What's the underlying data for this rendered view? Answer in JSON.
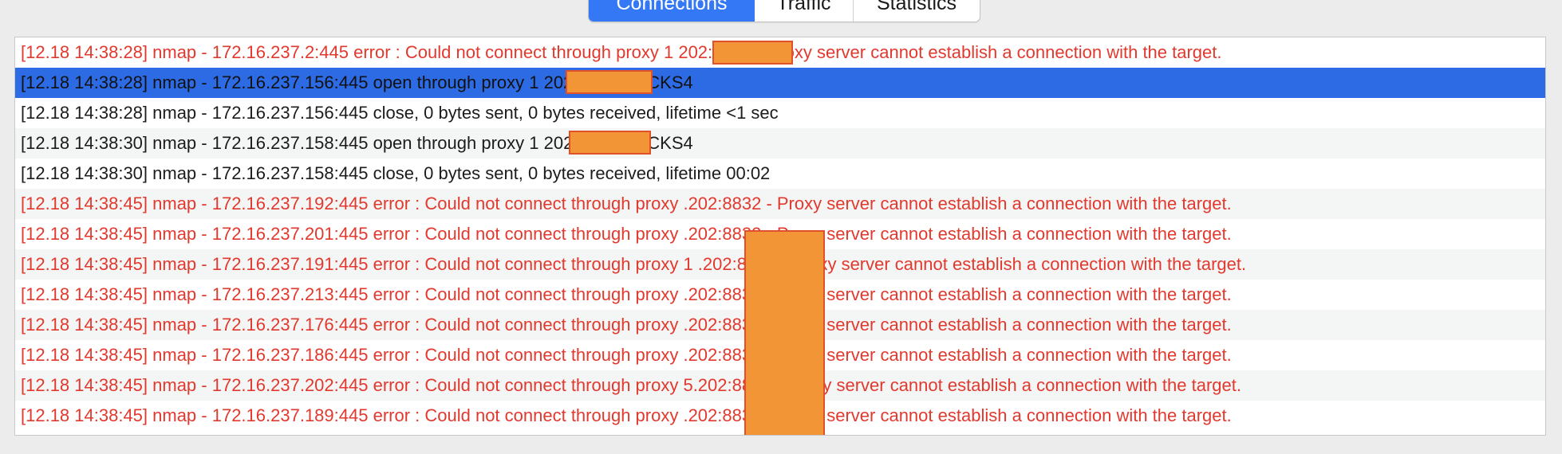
{
  "tabs": [
    {
      "label": "Connections",
      "active": true
    },
    {
      "label": "Traffic",
      "active": false
    },
    {
      "label": "Statistics",
      "active": false
    }
  ],
  "colors": {
    "error_text": "#e2392e",
    "selection": "#2d6be4",
    "tab_active": "#3478f6",
    "redaction": "#f29536"
  },
  "log_entries": [
    {
      "text": "[12.18 14:38:28] nmap - 172.16.237.2:445 error : Could not connect through proxy 1          202:8832 - Proxy server cannot establish a connection with the target.",
      "type": "error"
    },
    {
      "text": "[12.18 14:38:28] nmap - 172.16.237.156:445 open through proxy 1          202:8832 SOCKS4",
      "type": "normal",
      "selected": true
    },
    {
      "text": "[12.18 14:38:28] nmap - 172.16.237.156:445 close, 0 bytes sent, 0 bytes received, lifetime <1 sec",
      "type": "normal"
    },
    {
      "text": "[12.18 14:38:30] nmap - 172.16.237.158:445 open through proxy 1          202:8832 SOCKS4",
      "type": "normal"
    },
    {
      "text": "[12.18 14:38:30] nmap - 172.16.237.158:445 close, 0 bytes sent, 0 bytes received, lifetime 00:02",
      "type": "normal"
    },
    {
      "text": "[12.18 14:38:45] nmap - 172.16.237.192:445 error : Could not connect through proxy            .202:8832 - Proxy server cannot establish a connection with the target.",
      "type": "error"
    },
    {
      "text": "[12.18 14:38:45] nmap - 172.16.237.201:445 error : Could not connect through proxy            .202:8832 - Proxy server cannot establish a connection with the target.",
      "type": "error"
    },
    {
      "text": "[12.18 14:38:45] nmap - 172.16.237.191:445 error : Could not connect through proxy 1          .202:8832 - Proxy server cannot establish a connection with the target.",
      "type": "error"
    },
    {
      "text": "[12.18 14:38:45] nmap - 172.16.237.213:445 error : Could not connect through proxy            .202:8832 - Proxy server cannot establish a connection with the target.",
      "type": "error"
    },
    {
      "text": "[12.18 14:38:45] nmap - 172.16.237.176:445 error : Could not connect through proxy            .202:8832 - Proxy server cannot establish a connection with the target.",
      "type": "error"
    },
    {
      "text": "[12.18 14:38:45] nmap - 172.16.237.186:445 error : Could not connect through proxy            .202:8832 - Proxy server cannot establish a connection with the target.",
      "type": "error"
    },
    {
      "text": "[12.18 14:38:45] nmap - 172.16.237.202:445 error : Could not connect through proxy           5.202:8832 - Proxy server cannot establish a connection with the target.",
      "type": "error"
    },
    {
      "text": "[12.18 14:38:45] nmap - 172.16.237.189:445 error : Could not connect through proxy            .202:8832 - Proxy server cannot establish a connection with the target.",
      "type": "error"
    }
  ]
}
